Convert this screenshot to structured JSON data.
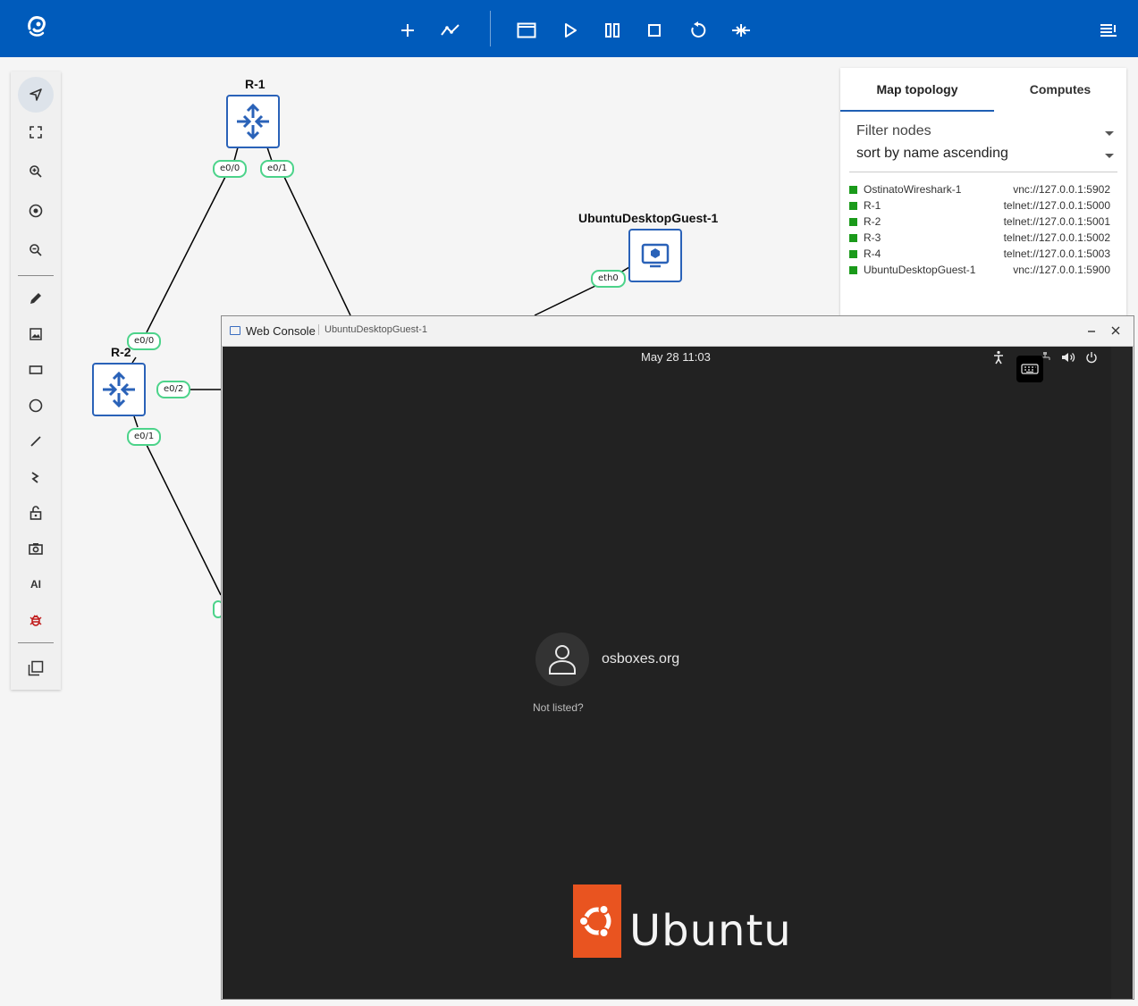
{
  "toolbar": {
    "buttons": [
      "add-node",
      "add-link",
      "console-all",
      "start-all",
      "suspend-all",
      "stop-all",
      "reload-all",
      "reset-all",
      "menu"
    ]
  },
  "rail": {
    "tools": [
      "select",
      "fit-view",
      "zoom-in",
      "reset-zoom",
      "zoom-out",
      "draw",
      "insert-image",
      "rectangle",
      "ellipse",
      "line",
      "curved-link",
      "lock",
      "screenshot",
      "ai",
      "debug",
      "layers"
    ],
    "ai_label": "AI"
  },
  "topology": {
    "nodes": [
      {
        "name": "R-1"
      },
      {
        "name": "R-2"
      },
      {
        "name": "UbuntuDesktopGuest-1"
      }
    ],
    "ports": {
      "r1_a": "e0/0",
      "r1_b": "e0/1",
      "r2_a": "e0/0",
      "r2_b": "e0/2",
      "r2_c": "e0/1",
      "ubuntu": "eth0"
    }
  },
  "panel": {
    "tabs": [
      "Map topology",
      "Computes"
    ],
    "filter_placeholder": "Filter nodes",
    "sort_value": "sort by name ascending",
    "status_color": "#1a9a1a",
    "nodes": [
      {
        "name": "OstinatoWireshark-1",
        "url": "vnc://127.0.0.1:5902"
      },
      {
        "name": "R-1",
        "url": "telnet://127.0.0.1:5000"
      },
      {
        "name": "R-2",
        "url": "telnet://127.0.0.1:5001"
      },
      {
        "name": "R-3",
        "url": "telnet://127.0.0.1:5002"
      },
      {
        "name": "R-4",
        "url": "telnet://127.0.0.1:5003"
      },
      {
        "name": "UbuntuDesktopGuest-1",
        "url": "vnc://127.0.0.1:5900"
      }
    ]
  },
  "console": {
    "title": "Web Console",
    "subtitle": "UbuntuDesktopGuest-1",
    "clock": "May 28  11:03",
    "username": "osboxes.org",
    "not_listed": "Not listed?",
    "brand": "Ubuntu",
    "brand_color": "#e95420"
  },
  "colors": {
    "toolbar": "#005bbb",
    "node_border": "#2a62b8",
    "port_border": "#4cd38a"
  }
}
